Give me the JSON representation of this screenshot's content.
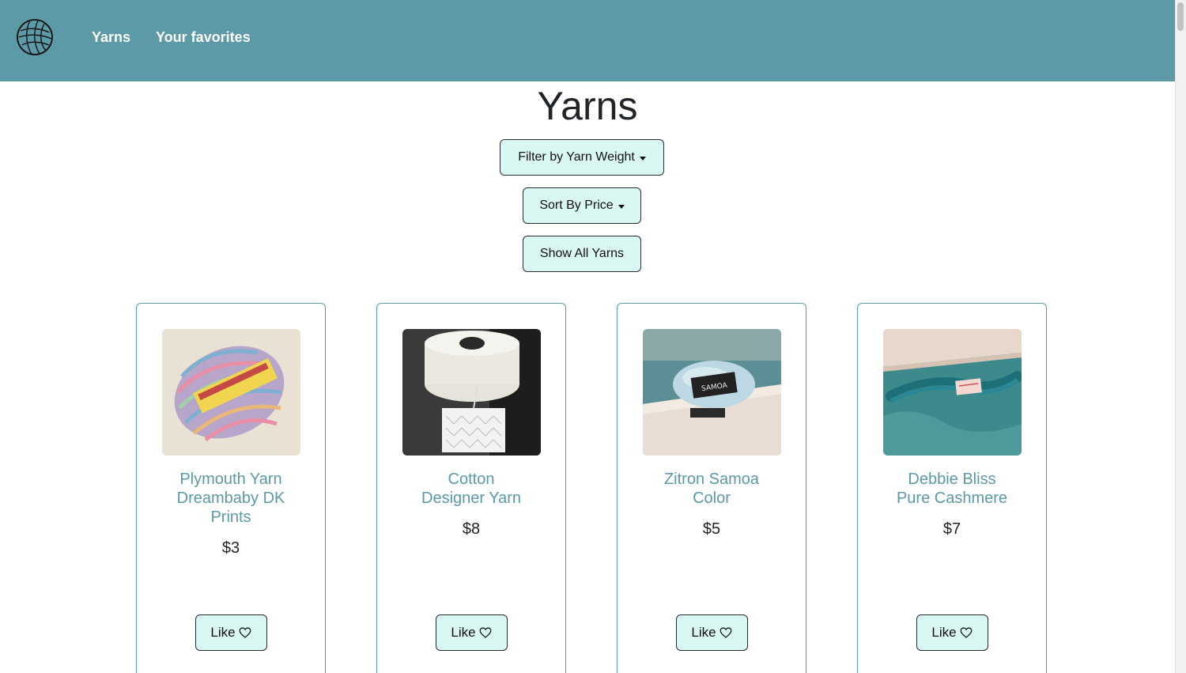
{
  "nav": {
    "logo_icon": "yarn-ball-icon",
    "links": [
      "Yarns",
      "Your favorites"
    ],
    "background": "#5b9aa6"
  },
  "main": {
    "title": "Yarns",
    "filter_label": "Filter by Yarn Weight",
    "sort_label": "Sort By Price",
    "show_all_label": "Show All Yarns",
    "button_color": "#d9f7f3"
  },
  "cards": [
    {
      "title_lines": [
        "Plymouth Yarn",
        "Dreambaby DK",
        "Prints"
      ],
      "price": "$3",
      "like_label": "Like",
      "image": "multicolor yarn skein"
    },
    {
      "title_lines": [
        "Cotton",
        "Designer Yarn"
      ],
      "price": "$8",
      "like_label": "Like",
      "image": "white cotton cone with lace swatch"
    },
    {
      "title_lines": [
        "Zitron Samoa",
        "Color"
      ],
      "price": "$5",
      "like_label": "Like",
      "image": "light blue yarn skein on box"
    },
    {
      "title_lines": [
        "Debbie Bliss",
        "Pure Cashmere"
      ],
      "price": "$7",
      "like_label": "Like",
      "image": "teal yarn hank on box"
    }
  ],
  "accent_color": "#5b9aa6"
}
